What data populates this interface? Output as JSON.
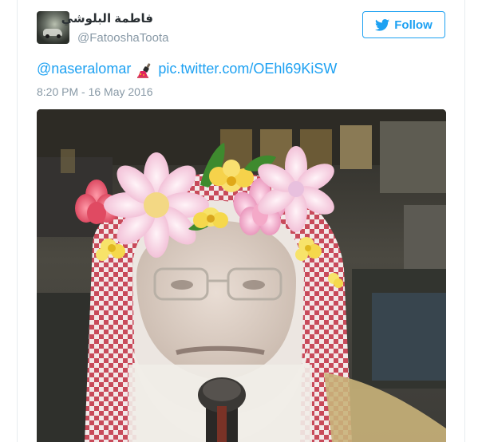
{
  "tweet": {
    "display_name": "فاطمة البلوشي",
    "handle": "@FatooshaToota",
    "follow_label": "Follow",
    "mention": "@naseralomar",
    "emoji_name": "nail-polish-emoji",
    "link": "pic.twitter.com/OEhl69KiSW",
    "timestamp": "8:20 PM - 16 May 2016",
    "photo_description": "man with flower crown filter"
  },
  "colors": {
    "accent": "#1da1f2",
    "name_text": "#292f33",
    "secondary_text": "#8899a6",
    "border": "#e6ecf0"
  },
  "icons": {
    "follow": "twitter-bird-icon"
  }
}
